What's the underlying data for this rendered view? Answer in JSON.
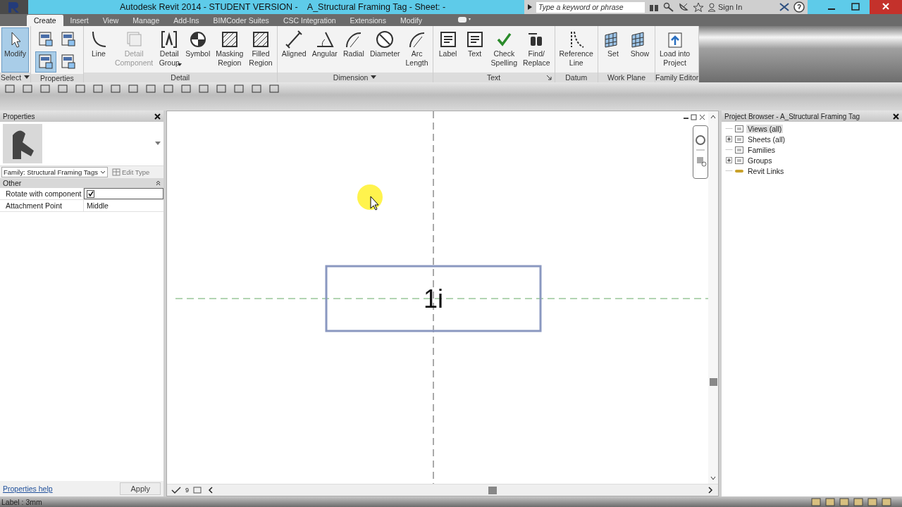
{
  "window": {
    "title": "Autodesk Revit 2014 - STUDENT VERSION -    A_Structural Framing Tag - Sheet: -",
    "search": {
      "placeholder": "Type a keyword or phrase"
    },
    "sign_in": "Sign In"
  },
  "ribbon": {
    "tabs": [
      {
        "label": "Create",
        "selected": true
      },
      {
        "label": "Insert",
        "selected": false
      },
      {
        "label": "View",
        "selected": false
      },
      {
        "label": "Manage",
        "selected": false
      },
      {
        "label": "Add-Ins",
        "selected": false
      },
      {
        "label": "BIMCoder Suites",
        "selected": false
      },
      {
        "label": "CSC Integration",
        "selected": false
      },
      {
        "label": "Extensions",
        "selected": false
      },
      {
        "label": "Modify",
        "selected": false
      }
    ],
    "panels": [
      {
        "label": "Select",
        "dropdown": true,
        "launcher": false,
        "tools": [
          {
            "kind": "large",
            "lines": [
              "Modify"
            ],
            "selected": true,
            "disabled": false,
            "dropdown": false
          }
        ]
      },
      {
        "label": "Properties",
        "dropdown": false,
        "launcher": false,
        "tools": [
          {
            "kind": "small",
            "selected": false
          },
          {
            "kind": "small",
            "selected": false
          },
          {
            "kind": "small",
            "selected": true
          },
          {
            "kind": "small",
            "selected": false
          }
        ]
      },
      {
        "label": "Detail",
        "dropdown": false,
        "launcher": false,
        "tools": [
          {
            "kind": "large",
            "lines": [
              "Line"
            ],
            "selected": false,
            "disabled": false,
            "dropdown": false
          },
          {
            "kind": "large",
            "lines": [
              "Detail",
              "Component"
            ],
            "selected": false,
            "disabled": true,
            "dropdown": false
          },
          {
            "kind": "large",
            "lines": [
              "Detail",
              "Group"
            ],
            "selected": false,
            "disabled": false,
            "dropdown": true
          },
          {
            "kind": "large",
            "lines": [
              "Symbol"
            ],
            "selected": false,
            "disabled": false,
            "dropdown": false
          },
          {
            "kind": "large",
            "lines": [
              "Masking",
              "Region"
            ],
            "selected": false,
            "disabled": false,
            "dropdown": false
          },
          {
            "kind": "large",
            "lines": [
              "Filled",
              "Region"
            ],
            "selected": false,
            "disabled": false,
            "dropdown": false
          }
        ]
      },
      {
        "label": "Dimension",
        "dropdown": true,
        "launcher": false,
        "tools": [
          {
            "kind": "large",
            "lines": [
              "Aligned"
            ],
            "selected": false,
            "disabled": false,
            "dropdown": false
          },
          {
            "kind": "large",
            "lines": [
              "Angular"
            ],
            "selected": false,
            "disabled": false,
            "dropdown": false
          },
          {
            "kind": "large",
            "lines": [
              "Radial"
            ],
            "selected": false,
            "disabled": false,
            "dropdown": false
          },
          {
            "kind": "large",
            "lines": [
              "Diameter"
            ],
            "selected": false,
            "disabled": false,
            "dropdown": false
          },
          {
            "kind": "large",
            "lines": [
              "Arc",
              "Length"
            ],
            "selected": false,
            "disabled": false,
            "dropdown": false
          }
        ]
      },
      {
        "label": "Text",
        "dropdown": false,
        "launcher": true,
        "tools": [
          {
            "kind": "large",
            "lines": [
              "Label"
            ],
            "selected": false,
            "disabled": false,
            "dropdown": false
          },
          {
            "kind": "large",
            "lines": [
              "Text"
            ],
            "selected": false,
            "disabled": false,
            "dropdown": false
          },
          {
            "kind": "large",
            "lines": [
              "Check",
              "Spelling"
            ],
            "selected": false,
            "disabled": false,
            "dropdown": false
          },
          {
            "kind": "large",
            "lines": [
              "Find/",
              "Replace"
            ],
            "selected": false,
            "disabled": false,
            "dropdown": false
          }
        ]
      },
      {
        "label": "Datum",
        "dropdown": false,
        "launcher": false,
        "tools": [
          {
            "kind": "large",
            "lines": [
              "Reference",
              "Line"
            ],
            "selected": false,
            "disabled": false,
            "dropdown": false
          }
        ]
      },
      {
        "label": "Work Plane",
        "dropdown": false,
        "launcher": false,
        "tools": [
          {
            "kind": "large",
            "lines": [
              "Set"
            ],
            "selected": false,
            "disabled": false,
            "dropdown": false
          },
          {
            "kind": "large",
            "lines": [
              "Show"
            ],
            "selected": false,
            "disabled": false,
            "dropdown": false
          }
        ]
      },
      {
        "label": "Family Editor",
        "dropdown": false,
        "launcher": false,
        "tools": [
          {
            "kind": "large",
            "lines": [
              "Load into",
              "Project"
            ],
            "selected": false,
            "disabled": false,
            "dropdown": false
          }
        ]
      }
    ]
  },
  "properties": {
    "title": "Properties",
    "type_selector": "Family: Structural Framing Tags",
    "edit_type": "Edit Type",
    "group": "Other",
    "rows": [
      {
        "kind": "checkbox",
        "name": "Rotate with component",
        "checked": true
      },
      {
        "kind": "text",
        "name": "Attachment Point",
        "value": "Middle"
      }
    ],
    "help_link": "Properties help",
    "apply": "Apply"
  },
  "canvas": {
    "tag_text": "1i",
    "view_scale": "9"
  },
  "project_browser": {
    "title": "Project Browser - A_Structural Framing Tag",
    "items": [
      {
        "label": "Views (all)",
        "selected": true,
        "expandable": false
      },
      {
        "label": "Sheets (all)",
        "selected": false,
        "expandable": true
      },
      {
        "label": "Families",
        "selected": false,
        "expandable": false
      },
      {
        "label": "Groups",
        "selected": false,
        "expandable": true
      },
      {
        "label": "Revit Links",
        "selected": false,
        "expandable": false
      }
    ]
  },
  "status_bar": {
    "text": "Label : 3mm"
  }
}
